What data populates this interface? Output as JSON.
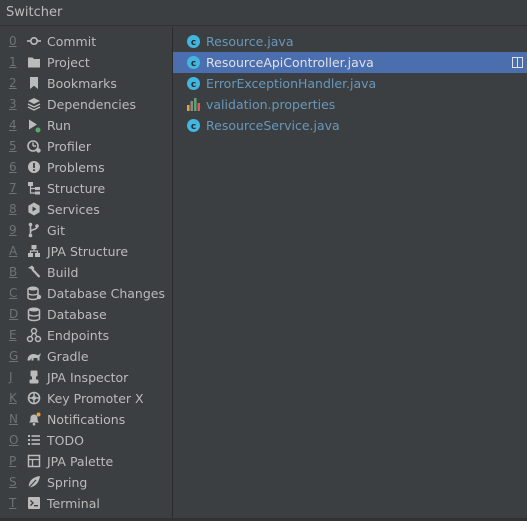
{
  "window": {
    "title": "Switcher"
  },
  "toolwindows": [
    {
      "mnemonic": "0",
      "label": "Commit"
    },
    {
      "mnemonic": "1",
      "label": "Project"
    },
    {
      "mnemonic": "2",
      "label": "Bookmarks"
    },
    {
      "mnemonic": "3",
      "label": "Dependencies"
    },
    {
      "mnemonic": "4",
      "label": "Run"
    },
    {
      "mnemonic": "5",
      "label": "Profiler"
    },
    {
      "mnemonic": "6",
      "label": "Problems"
    },
    {
      "mnemonic": "7",
      "label": "Structure"
    },
    {
      "mnemonic": "8",
      "label": "Services"
    },
    {
      "mnemonic": "9",
      "label": "Git"
    },
    {
      "mnemonic": "A",
      "label": "JPA Structure"
    },
    {
      "mnemonic": "B",
      "label": "Build"
    },
    {
      "mnemonic": "C",
      "label": "Database Changes"
    },
    {
      "mnemonic": "D",
      "label": "Database"
    },
    {
      "mnemonic": "E",
      "label": "Endpoints"
    },
    {
      "mnemonic": "G",
      "label": "Gradle"
    },
    {
      "mnemonic": "J",
      "label": "JPA Inspector"
    },
    {
      "mnemonic": "K",
      "label": "Key Promoter X"
    },
    {
      "mnemonic": "N",
      "label": "Notifications"
    },
    {
      "mnemonic": "O",
      "label": "TODO"
    },
    {
      "mnemonic": "P",
      "label": "JPA Palette"
    },
    {
      "mnemonic": "S",
      "label": "Spring"
    },
    {
      "mnemonic": "T",
      "label": "Terminal"
    }
  ],
  "recent_files": [
    {
      "name": "Resource.java",
      "icon": "java-class-icon"
    },
    {
      "name": "ResourceApiController.java",
      "icon": "java-class-icon",
      "selected": true
    },
    {
      "name": "ErrorExceptionHandler.java",
      "icon": "java-class-icon"
    },
    {
      "name": "validation.properties",
      "icon": "properties-file-icon"
    },
    {
      "name": "ResourceService.java",
      "icon": "java-class-icon"
    }
  ],
  "colors": {
    "background": "#3c3f41",
    "selection": "#4b6eaf",
    "file_text": "#6897bb",
    "java_icon": "#40b6e0"
  }
}
